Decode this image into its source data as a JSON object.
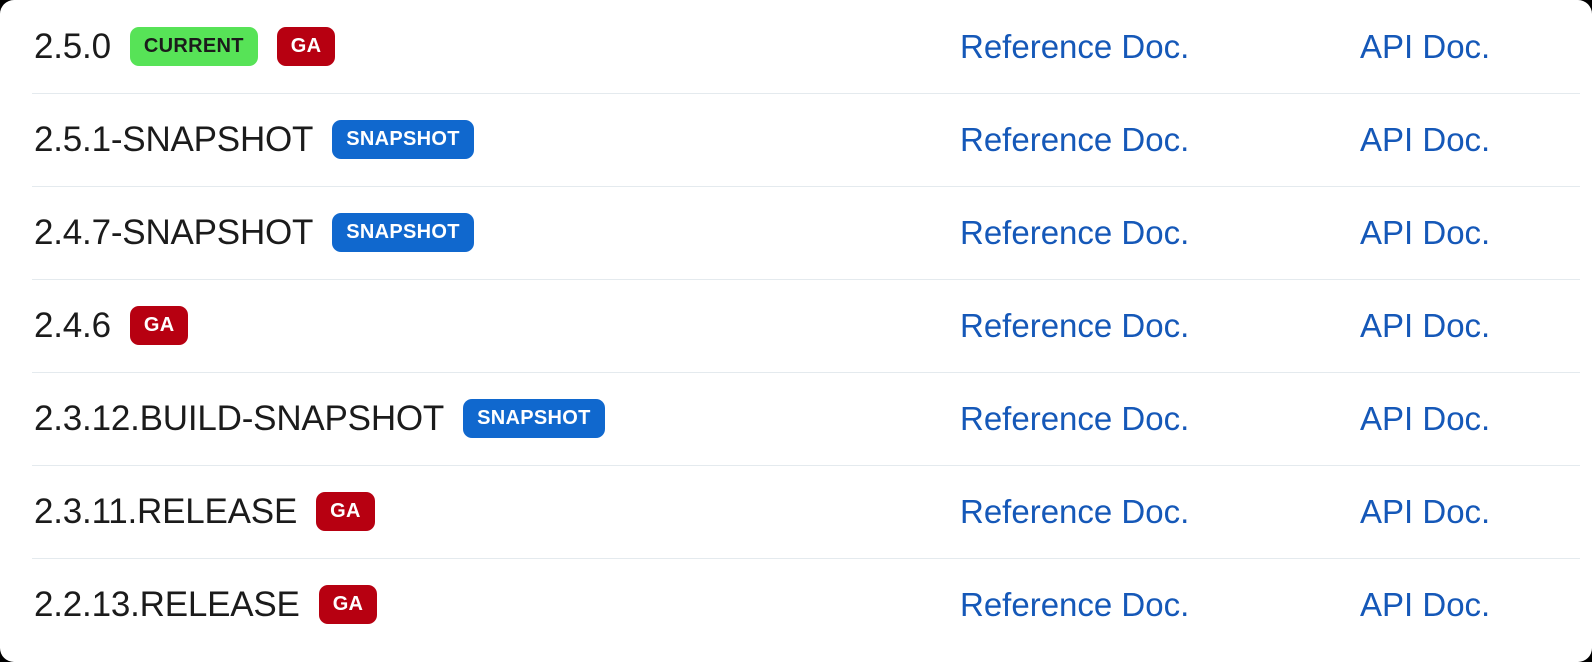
{
  "page": {
    "background_color": "#ffffff",
    "divider_color": "#e4eaee"
  },
  "colors": {
    "badge_current_bg": "#57e357",
    "badge_current_text": "#1b1b1b",
    "badge_ga_bg": "#b70011",
    "badge_ga_text": "#ffffff",
    "badge_snapshot_bg": "#1068ce",
    "badge_snapshot_text": "#ffffff",
    "link": "#1558b8",
    "version_text": "#1b1b1b"
  },
  "links": {
    "reference_label": "Reference Doc.",
    "api_label": "API Doc."
  },
  "rows": [
    {
      "version": "2.5.0",
      "badges": [
        {
          "label": "CURRENT",
          "type": "current"
        },
        {
          "label": "GA",
          "type": "ga"
        }
      ],
      "reference_doc": "Reference Doc.",
      "api_doc": "API Doc."
    },
    {
      "version": "2.5.1-SNAPSHOT",
      "badges": [
        {
          "label": "SNAPSHOT",
          "type": "snapshot"
        }
      ],
      "reference_doc": "Reference Doc.",
      "api_doc": "API Doc."
    },
    {
      "version": "2.4.7-SNAPSHOT",
      "badges": [
        {
          "label": "SNAPSHOT",
          "type": "snapshot"
        }
      ],
      "reference_doc": "Reference Doc.",
      "api_doc": "API Doc."
    },
    {
      "version": "2.4.6",
      "badges": [
        {
          "label": "GA",
          "type": "ga"
        }
      ],
      "reference_doc": "Reference Doc.",
      "api_doc": "API Doc."
    },
    {
      "version": "2.3.12.BUILD-SNAPSHOT",
      "badges": [
        {
          "label": "SNAPSHOT",
          "type": "snapshot"
        }
      ],
      "reference_doc": "Reference Doc.",
      "api_doc": "API Doc."
    },
    {
      "version": "2.3.11.RELEASE",
      "badges": [
        {
          "label": "GA",
          "type": "ga"
        }
      ],
      "reference_doc": "Reference Doc.",
      "api_doc": "API Doc."
    },
    {
      "version": "2.2.13.RELEASE",
      "badges": [
        {
          "label": "GA",
          "type": "ga"
        }
      ],
      "reference_doc": "Reference Doc.",
      "api_doc": "API Doc."
    }
  ]
}
